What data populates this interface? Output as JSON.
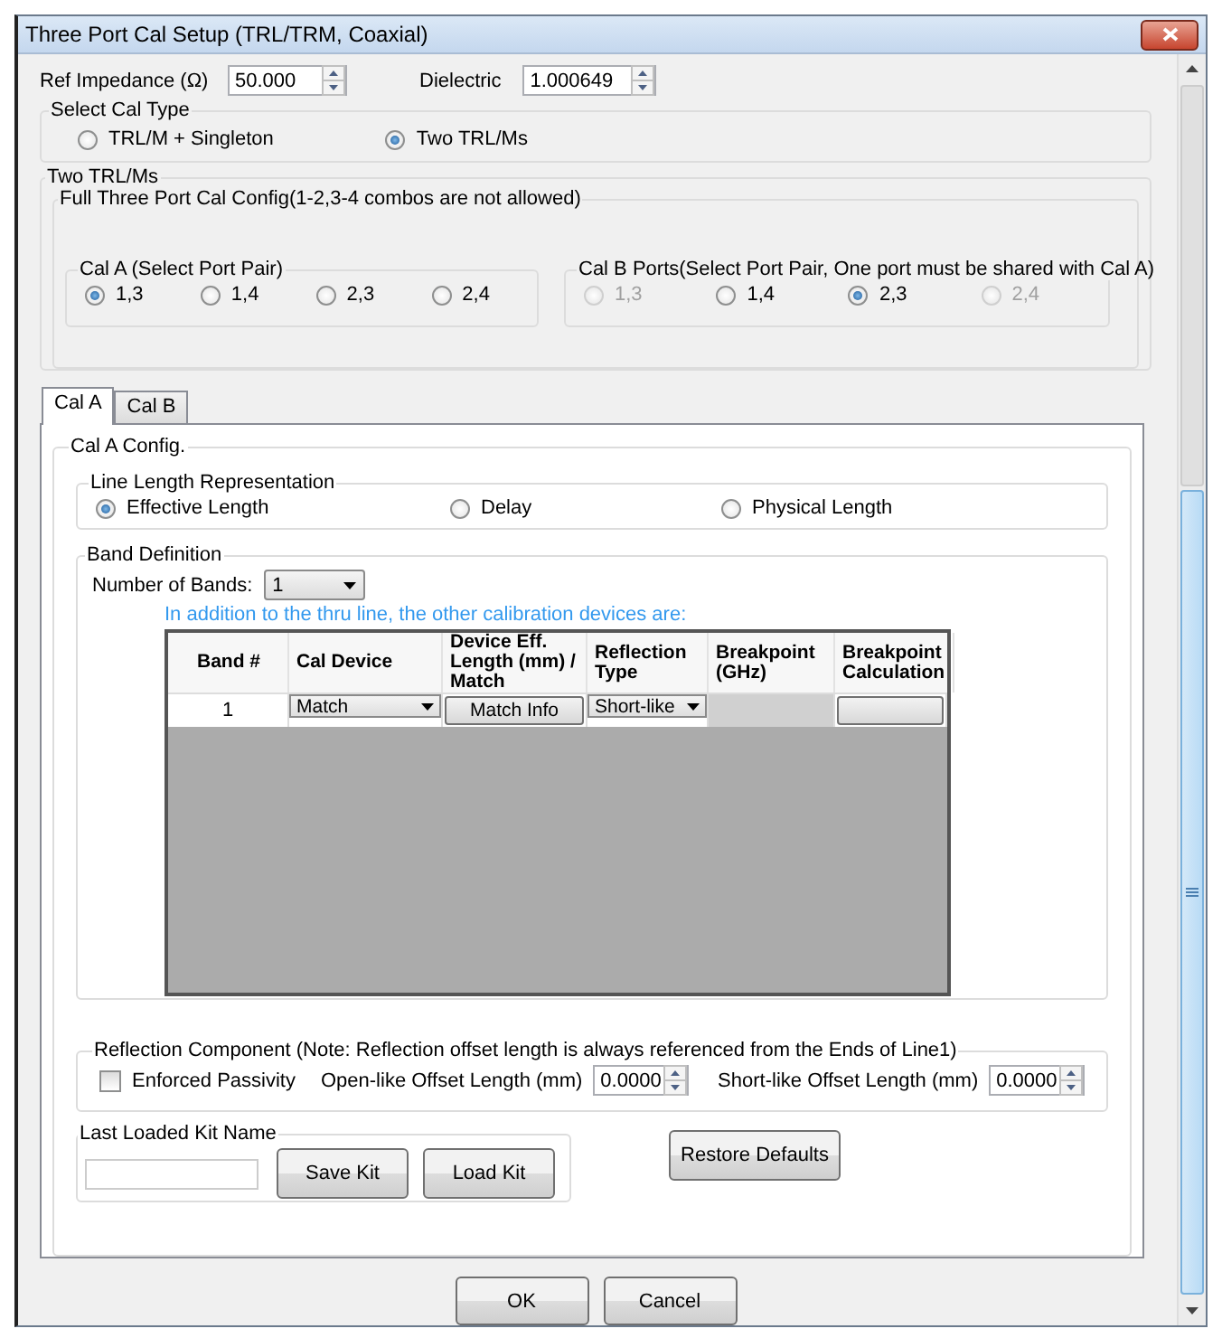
{
  "window": {
    "title": "Three Port Cal Setup (TRL/TRM, Coaxial)"
  },
  "ref_impedance": {
    "label": "Ref Impedance (Ω)",
    "value": "50.000"
  },
  "dielectric": {
    "label": "Dielectric",
    "value": "1.000649"
  },
  "cal_type": {
    "title": "Select Cal Type",
    "options": [
      {
        "label": "TRL/M + Singleton",
        "selected": false
      },
      {
        "label": "Two TRL/Ms",
        "selected": true
      }
    ]
  },
  "two_trlms": {
    "title": "Two TRL/Ms",
    "config_title": "Full Three Port Cal Config(1-2,3-4 combos are not allowed)",
    "cal_a": {
      "title": "Cal A (Select Port Pair)",
      "options": [
        {
          "label": "1,3",
          "selected": true,
          "disabled": false
        },
        {
          "label": "1,4",
          "selected": false,
          "disabled": false
        },
        {
          "label": "2,3",
          "selected": false,
          "disabled": false
        },
        {
          "label": "2,4",
          "selected": false,
          "disabled": false
        }
      ]
    },
    "cal_b": {
      "title": "Cal B Ports(Select Port Pair, One port must be shared with Cal A)",
      "options": [
        {
          "label": "1,3",
          "selected": false,
          "disabled": true
        },
        {
          "label": "1,4",
          "selected": false,
          "disabled": false
        },
        {
          "label": "2,3",
          "selected": true,
          "disabled": false
        },
        {
          "label": "2,4",
          "selected": false,
          "disabled": true
        }
      ]
    }
  },
  "tabs": [
    {
      "label": "Cal A",
      "selected": true
    },
    {
      "label": "Cal B",
      "selected": false
    }
  ],
  "config_title": "Cal A Config.",
  "line_length": {
    "title": "Line Length Representation",
    "options": [
      {
        "label": "Effective Length",
        "selected": true
      },
      {
        "label": "Delay",
        "selected": false
      },
      {
        "label": "Physical Length",
        "selected": false
      }
    ]
  },
  "band_definition": {
    "title": "Band Definition",
    "bands_label": "Number of Bands:",
    "bands_value": "1",
    "note": "In addition to the thru line, the other calibration devices are:",
    "table": {
      "columns": [
        "Band #",
        "Cal Device",
        "Device Eff. Length (mm) / Match",
        "Reflection Type",
        "Breakpoint (GHz)",
        "Breakpoint Calculation"
      ],
      "rows": [
        {
          "cells": [
            {
              "kind": "text",
              "text": "1"
            },
            {
              "kind": "dropdown",
              "text": "Match"
            },
            {
              "kind": "button",
              "text": "Match Info"
            },
            {
              "kind": "dropdown",
              "text": "Short-like"
            },
            {
              "kind": "disabled"
            },
            {
              "kind": "button"
            }
          ]
        }
      ]
    }
  },
  "reflection": {
    "title": "Reflection Component (Note: Reflection offset length is always referenced from the Ends of Line1)",
    "passivity": {
      "label": "Enforced Passivity",
      "checked": false
    },
    "open_label": "Open-like Offset Length (mm)",
    "open_value": "0.0000",
    "short_label": "Short-like Offset Length (mm)",
    "short_value": "0.0000"
  },
  "kit": {
    "title": "Last Loaded Kit Name",
    "buttons": [
      "Save Kit",
      "Load Kit"
    ]
  },
  "restore_button": "Restore Defaults",
  "buttons": [
    "OK",
    "Cancel"
  ]
}
